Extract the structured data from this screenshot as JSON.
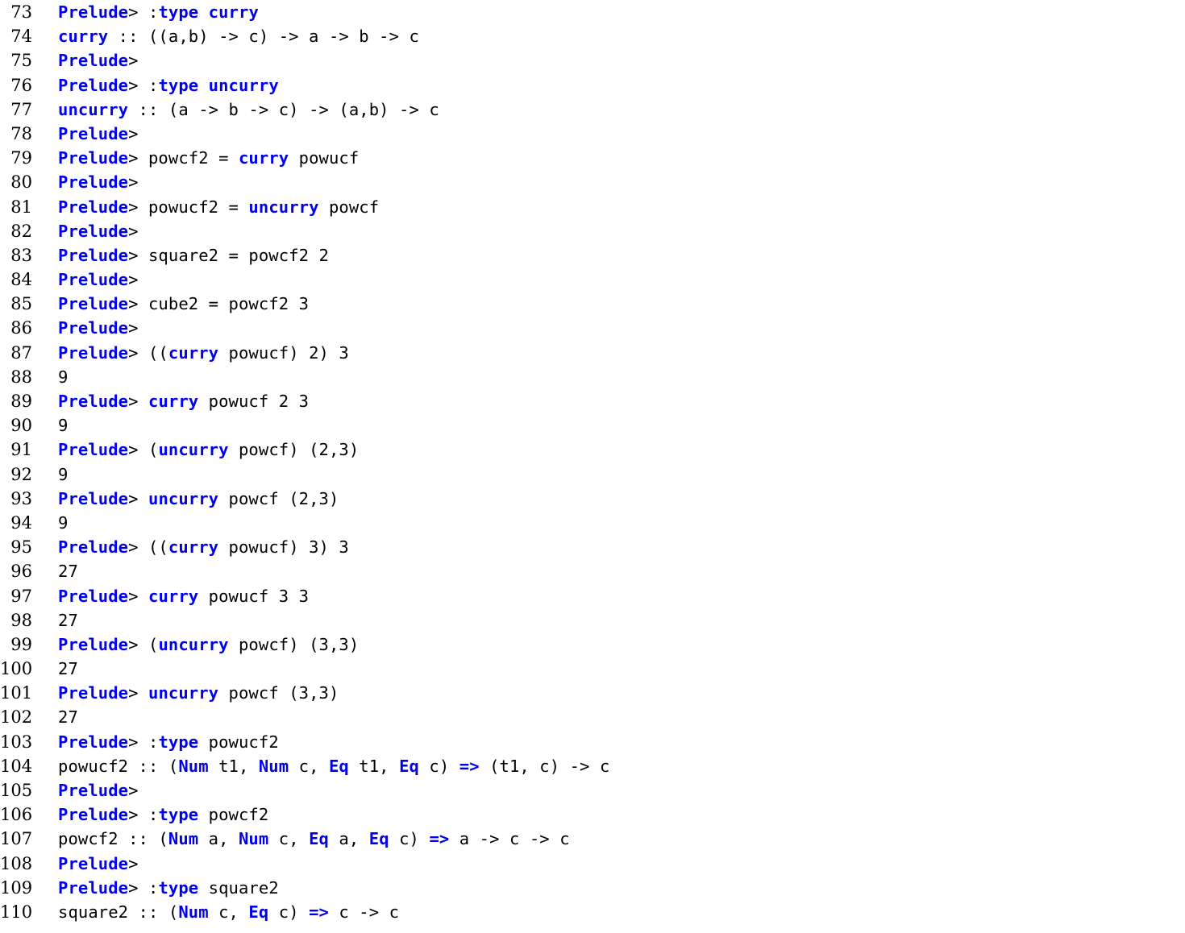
{
  "document": {
    "kind": "ghci-session-code-listing",
    "first_line_number": 73,
    "last_line_number": 110,
    "background_color": "#ffffff",
    "keyword_color": "#0000ee",
    "plain_color": "#000000"
  },
  "lines": [
    {
      "number": "73",
      "text": "Prelude> :type curry",
      "tokens": [
        {
          "t": "Prelude",
          "kw": true
        },
        {
          "t": "> :",
          "kw": false
        },
        {
          "t": "type",
          "kw": true
        },
        {
          "t": " ",
          "kw": false
        },
        {
          "t": "curry",
          "kw": true
        }
      ]
    },
    {
      "number": "74",
      "text": "curry :: ((a,b) -> c) -> a -> b -> c",
      "tokens": [
        {
          "t": "curry",
          "kw": true
        },
        {
          "t": " :: ((a,b) -> c) -> a -> b -> c",
          "kw": false
        }
      ]
    },
    {
      "number": "75",
      "text": "Prelude>",
      "tokens": [
        {
          "t": "Prelude",
          "kw": true
        },
        {
          "t": ">",
          "kw": false
        }
      ]
    },
    {
      "number": "76",
      "text": "Prelude> :type uncurry",
      "tokens": [
        {
          "t": "Prelude",
          "kw": true
        },
        {
          "t": "> :",
          "kw": false
        },
        {
          "t": "type",
          "kw": true
        },
        {
          "t": " ",
          "kw": false
        },
        {
          "t": "uncurry",
          "kw": true
        }
      ]
    },
    {
      "number": "77",
      "text": "uncurry :: (a -> b -> c) -> (a,b) -> c",
      "tokens": [
        {
          "t": "uncurry",
          "kw": true
        },
        {
          "t": " :: (a -> b -> c) -> (a,b) -> c",
          "kw": false
        }
      ]
    },
    {
      "number": "78",
      "text": "Prelude>",
      "tokens": [
        {
          "t": "Prelude",
          "kw": true
        },
        {
          "t": ">",
          "kw": false
        }
      ]
    },
    {
      "number": "79",
      "text": "Prelude> powcf2 = curry powucf",
      "tokens": [
        {
          "t": "Prelude",
          "kw": true
        },
        {
          "t": "> powcf2 = ",
          "kw": false
        },
        {
          "t": "curry",
          "kw": true
        },
        {
          "t": " powucf",
          "kw": false
        }
      ]
    },
    {
      "number": "80",
      "text": "Prelude>",
      "tokens": [
        {
          "t": "Prelude",
          "kw": true
        },
        {
          "t": ">",
          "kw": false
        }
      ]
    },
    {
      "number": "81",
      "text": "Prelude> powucf2 = uncurry powcf",
      "tokens": [
        {
          "t": "Prelude",
          "kw": true
        },
        {
          "t": "> powucf2 = ",
          "kw": false
        },
        {
          "t": "uncurry",
          "kw": true
        },
        {
          "t": " powcf",
          "kw": false
        }
      ]
    },
    {
      "number": "82",
      "text": "Prelude>",
      "tokens": [
        {
          "t": "Prelude",
          "kw": true
        },
        {
          "t": ">",
          "kw": false
        }
      ]
    },
    {
      "number": "83",
      "text": "Prelude> square2 = powcf2 2",
      "tokens": [
        {
          "t": "Prelude",
          "kw": true
        },
        {
          "t": "> square2 = powcf2 2",
          "kw": false
        }
      ]
    },
    {
      "number": "84",
      "text": "Prelude>",
      "tokens": [
        {
          "t": "Prelude",
          "kw": true
        },
        {
          "t": ">",
          "kw": false
        }
      ]
    },
    {
      "number": "85",
      "text": "Prelude> cube2 = powcf2 3",
      "tokens": [
        {
          "t": "Prelude",
          "kw": true
        },
        {
          "t": "> cube2 = powcf2 3",
          "kw": false
        }
      ]
    },
    {
      "number": "86",
      "text": "Prelude>",
      "tokens": [
        {
          "t": "Prelude",
          "kw": true
        },
        {
          "t": ">",
          "kw": false
        }
      ]
    },
    {
      "number": "87",
      "text": "Prelude> ((curry powucf) 2) 3",
      "tokens": [
        {
          "t": "Prelude",
          "kw": true
        },
        {
          "t": "> ((",
          "kw": false
        },
        {
          "t": "curry",
          "kw": true
        },
        {
          "t": " powucf) 2) 3",
          "kw": false
        }
      ]
    },
    {
      "number": "88",
      "text": "9",
      "tokens": [
        {
          "t": "9",
          "kw": false
        }
      ]
    },
    {
      "number": "89",
      "text": "Prelude> curry powucf 2 3",
      "tokens": [
        {
          "t": "Prelude",
          "kw": true
        },
        {
          "t": "> ",
          "kw": false
        },
        {
          "t": "curry",
          "kw": true
        },
        {
          "t": " powucf 2 3",
          "kw": false
        }
      ]
    },
    {
      "number": "90",
      "text": "9",
      "tokens": [
        {
          "t": "9",
          "kw": false
        }
      ]
    },
    {
      "number": "91",
      "text": "Prelude> (uncurry powcf) (2,3)",
      "tokens": [
        {
          "t": "Prelude",
          "kw": true
        },
        {
          "t": "> (",
          "kw": false
        },
        {
          "t": "uncurry",
          "kw": true
        },
        {
          "t": " powcf) (2,3)",
          "kw": false
        }
      ]
    },
    {
      "number": "92",
      "text": "9",
      "tokens": [
        {
          "t": "9",
          "kw": false
        }
      ]
    },
    {
      "number": "93",
      "text": "Prelude> uncurry powcf (2,3)",
      "tokens": [
        {
          "t": "Prelude",
          "kw": true
        },
        {
          "t": "> ",
          "kw": false
        },
        {
          "t": "uncurry",
          "kw": true
        },
        {
          "t": " powcf (2,3)",
          "kw": false
        }
      ]
    },
    {
      "number": "94",
      "text": "9",
      "tokens": [
        {
          "t": "9",
          "kw": false
        }
      ]
    },
    {
      "number": "95",
      "text": "Prelude> ((curry powucf) 3) 3",
      "tokens": [
        {
          "t": "Prelude",
          "kw": true
        },
        {
          "t": "> ((",
          "kw": false
        },
        {
          "t": "curry",
          "kw": true
        },
        {
          "t": " powucf) 3) 3",
          "kw": false
        }
      ]
    },
    {
      "number": "96",
      "text": "27",
      "tokens": [
        {
          "t": "27",
          "kw": false
        }
      ]
    },
    {
      "number": "97",
      "text": "Prelude> curry powucf 3 3",
      "tokens": [
        {
          "t": "Prelude",
          "kw": true
        },
        {
          "t": "> ",
          "kw": false
        },
        {
          "t": "curry",
          "kw": true
        },
        {
          "t": " powucf 3 3",
          "kw": false
        }
      ]
    },
    {
      "number": "98",
      "text": "27",
      "tokens": [
        {
          "t": "27",
          "kw": false
        }
      ]
    },
    {
      "number": "99",
      "text": "Prelude> (uncurry powcf) (3,3)",
      "tokens": [
        {
          "t": "Prelude",
          "kw": true
        },
        {
          "t": "> (",
          "kw": false
        },
        {
          "t": "uncurry",
          "kw": true
        },
        {
          "t": " powcf) (3,3)",
          "kw": false
        }
      ]
    },
    {
      "number": "100",
      "text": "27",
      "tokens": [
        {
          "t": "27",
          "kw": false
        }
      ]
    },
    {
      "number": "101",
      "text": "Prelude> uncurry powcf (3,3)",
      "tokens": [
        {
          "t": "Prelude",
          "kw": true
        },
        {
          "t": "> ",
          "kw": false
        },
        {
          "t": "uncurry",
          "kw": true
        },
        {
          "t": " powcf (3,3)",
          "kw": false
        }
      ]
    },
    {
      "number": "102",
      "text": "27",
      "tokens": [
        {
          "t": "27",
          "kw": false
        }
      ]
    },
    {
      "number": "103",
      "text": "Prelude> :type powucf2",
      "tokens": [
        {
          "t": "Prelude",
          "kw": true
        },
        {
          "t": "> :",
          "kw": false
        },
        {
          "t": "type",
          "kw": true
        },
        {
          "t": " powucf2",
          "kw": false
        }
      ]
    },
    {
      "number": "104",
      "text": "powucf2 :: (Num t1, Num c, Eq t1, Eq c) => (t1, c) -> c",
      "tokens": [
        {
          "t": "powucf2 :: (",
          "kw": false
        },
        {
          "t": "Num",
          "kw": true
        },
        {
          "t": " t1, ",
          "kw": false
        },
        {
          "t": "Num",
          "kw": true
        },
        {
          "t": " c, ",
          "kw": false
        },
        {
          "t": "Eq",
          "kw": true
        },
        {
          "t": " t1, ",
          "kw": false
        },
        {
          "t": "Eq",
          "kw": true
        },
        {
          "t": " c) ",
          "kw": false
        },
        {
          "t": "=>",
          "kw": true
        },
        {
          "t": " (t1, c) -> c",
          "kw": false
        }
      ]
    },
    {
      "number": "105",
      "text": "Prelude>",
      "tokens": [
        {
          "t": "Prelude",
          "kw": true
        },
        {
          "t": ">",
          "kw": false
        }
      ]
    },
    {
      "number": "106",
      "text": "Prelude> :type powcf2",
      "tokens": [
        {
          "t": "Prelude",
          "kw": true
        },
        {
          "t": "> :",
          "kw": false
        },
        {
          "t": "type",
          "kw": true
        },
        {
          "t": " powcf2",
          "kw": false
        }
      ]
    },
    {
      "number": "107",
      "text": "powcf2 :: (Num a, Num c, Eq a, Eq c) => a -> c -> c",
      "tokens": [
        {
          "t": "powcf2 :: (",
          "kw": false
        },
        {
          "t": "Num",
          "kw": true
        },
        {
          "t": " a, ",
          "kw": false
        },
        {
          "t": "Num",
          "kw": true
        },
        {
          "t": " c, ",
          "kw": false
        },
        {
          "t": "Eq",
          "kw": true
        },
        {
          "t": " a, ",
          "kw": false
        },
        {
          "t": "Eq",
          "kw": true
        },
        {
          "t": " c) ",
          "kw": false
        },
        {
          "t": "=>",
          "kw": true
        },
        {
          "t": " a -> c -> c",
          "kw": false
        }
      ]
    },
    {
      "number": "108",
      "text": "Prelude>",
      "tokens": [
        {
          "t": "Prelude",
          "kw": true
        },
        {
          "t": ">",
          "kw": false
        }
      ]
    },
    {
      "number": "109",
      "text": "Prelude> :type square2",
      "tokens": [
        {
          "t": "Prelude",
          "kw": true
        },
        {
          "t": "> :",
          "kw": false
        },
        {
          "t": "type",
          "kw": true
        },
        {
          "t": " square2",
          "kw": false
        }
      ]
    },
    {
      "number": "110",
      "text": "square2 :: (Num c, Eq c) => c -> c",
      "tokens": [
        {
          "t": "square2 :: (",
          "kw": false
        },
        {
          "t": "Num",
          "kw": true
        },
        {
          "t": " c, ",
          "kw": false
        },
        {
          "t": "Eq",
          "kw": true
        },
        {
          "t": " c) ",
          "kw": false
        },
        {
          "t": "=>",
          "kw": true
        },
        {
          "t": " c -> c",
          "kw": false
        }
      ]
    }
  ]
}
